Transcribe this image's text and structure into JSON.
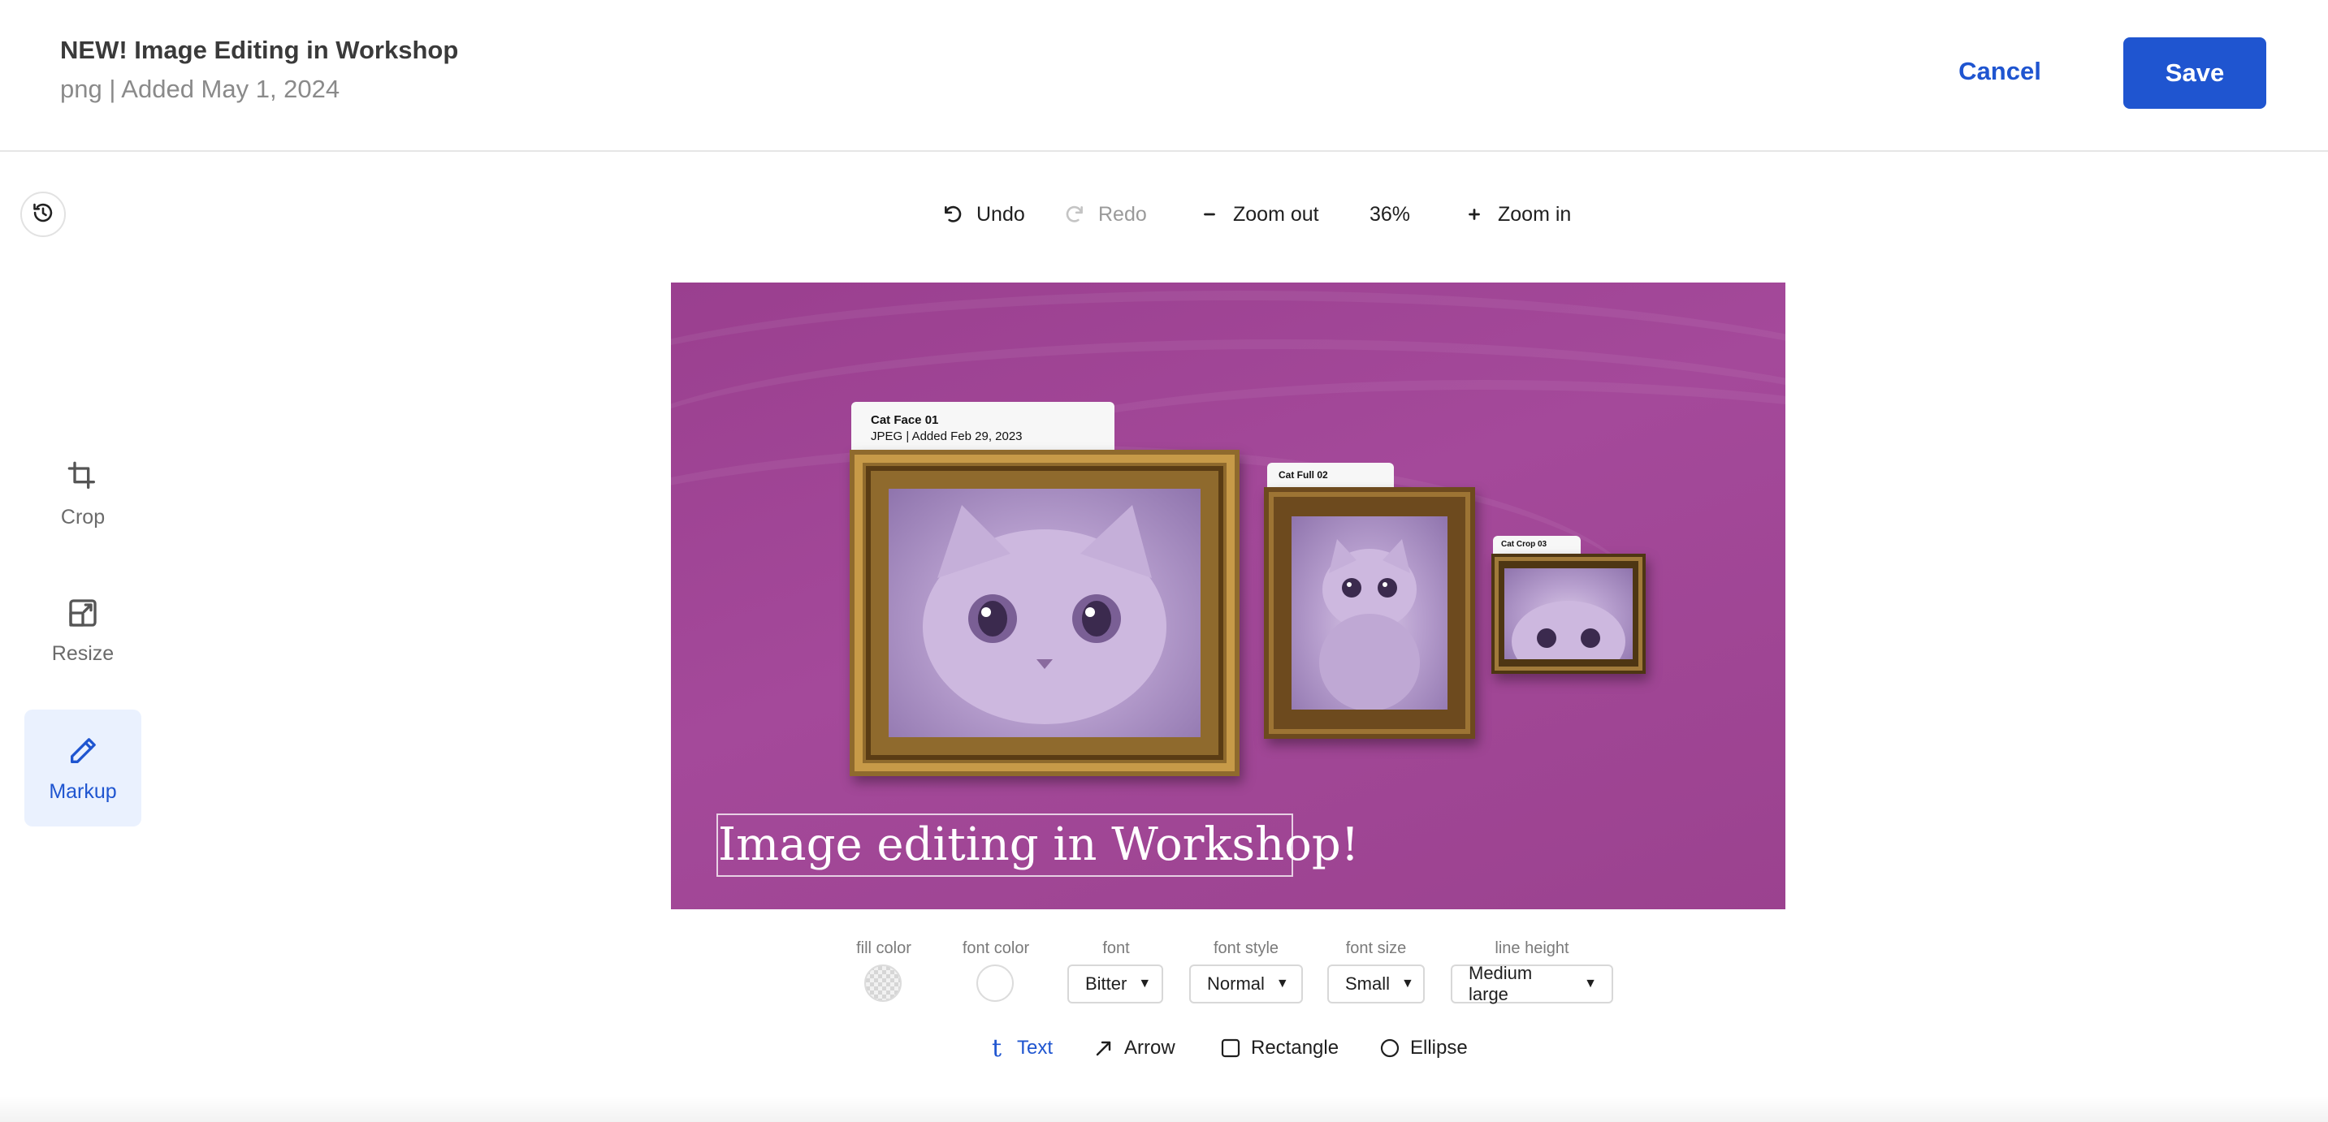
{
  "header": {
    "title": "NEW! Image Editing in Workshop",
    "subtitle": "png | Added May 1, 2024",
    "cancel_label": "Cancel",
    "save_label": "Save"
  },
  "toolbar": {
    "undo": "Undo",
    "redo": "Redo",
    "zoom_out": "Zoom out",
    "zoom_value": "36%",
    "zoom_in": "Zoom in"
  },
  "tools": [
    {
      "label": "Crop",
      "icon": "crop-icon"
    },
    {
      "label": "Resize",
      "icon": "resize-icon"
    },
    {
      "label": "Markup",
      "icon": "pencil-icon",
      "active": true
    }
  ],
  "canvas": {
    "background_color": "#a4499a",
    "cards": [
      {
        "title": "Cat Face 01",
        "meta": "JPEG | Added Feb 29, 2023"
      },
      {
        "title": "Cat Full 02"
      },
      {
        "title": "Cat Crop 03"
      }
    ],
    "text": "Image editing in Workshop!"
  },
  "properties": {
    "fill_color_label": "fill color",
    "font_color_label": "font color",
    "font_label": "font",
    "font_value": "Bitter",
    "font_style_label": "font style",
    "font_style_value": "Normal",
    "font_size_label": "font size",
    "font_size_value": "Small",
    "line_height_label": "line height",
    "line_height_value": "Medium large"
  },
  "shapes": {
    "text": "Text",
    "arrow": "Arrow",
    "rectangle": "Rectangle",
    "ellipse": "Ellipse"
  },
  "colors": {
    "accent": "#1f55d0",
    "active_tool_bg": "#eaf1fe"
  }
}
